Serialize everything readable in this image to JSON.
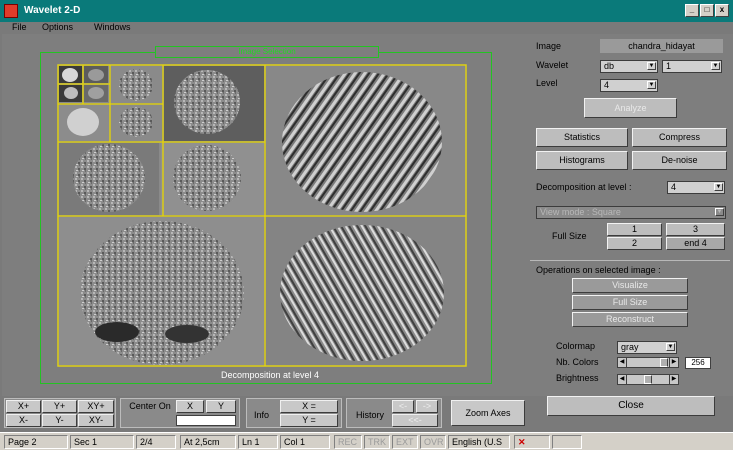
{
  "window": {
    "title": "Wavelet 2-D",
    "buttons": [
      "_",
      "□",
      "x"
    ]
  },
  "menu": [
    "File",
    "Options",
    "Windows"
  ],
  "image_area": {
    "selection_button": "Image Selection",
    "caption": "Decomposition at level 4"
  },
  "panel": {
    "image_label": "Image",
    "image_value": "chandra_hidayat",
    "wavelet_label": "Wavelet",
    "wavelet_family": "db",
    "wavelet_number": "1",
    "level_label": "Level",
    "level_value": "4",
    "analyze": "Analyze",
    "statistics": "Statistics",
    "compress": "Compress",
    "histograms": "Histograms",
    "denoise": "De-noise",
    "decomp_label": "Decomposition at level :",
    "decomp_value": "4",
    "view_mode": "View mode : Square",
    "full_size_label": "Full Size",
    "fs_1": "1",
    "fs_3": "3",
    "fs_2": "2",
    "fs_end4": "end 4",
    "ops_label": "Operations on selected image :",
    "visualize": "Visualize",
    "fullsize": "Full Size",
    "reconstruct": "Reconstruct",
    "colormap_label": "Colormap",
    "colormap_value": "gray",
    "nbcolors_label": "Nb. Colors",
    "nbcolors_value": "256",
    "brightness_label": "Brightness",
    "close": "Close"
  },
  "toolbar": {
    "xplus": "X+",
    "yplus": "Y+",
    "xyplus": "XY+",
    "xminus": "X-",
    "yminus": "Y-",
    "xyminus": "XY-",
    "center_on": "Center On",
    "cx": "X",
    "cy": "Y",
    "info": "Info",
    "x_eq": "X =",
    "y_eq": "Y =",
    "history": "History",
    "hist_fwd": "->",
    "hist_back": "<-",
    "hist_back2": "<<-",
    "zoom_axes": "Zoom Axes"
  },
  "status": {
    "page": "Page 2",
    "sec": "Sec 1",
    "pages": "2/4",
    "at": "At 2,5cm",
    "ln": "Ln 1",
    "col": "Col 1",
    "rec": "REC",
    "trk": "TRK",
    "ext": "EXT",
    "ovr": "OVR",
    "lang": "English (U.S"
  }
}
